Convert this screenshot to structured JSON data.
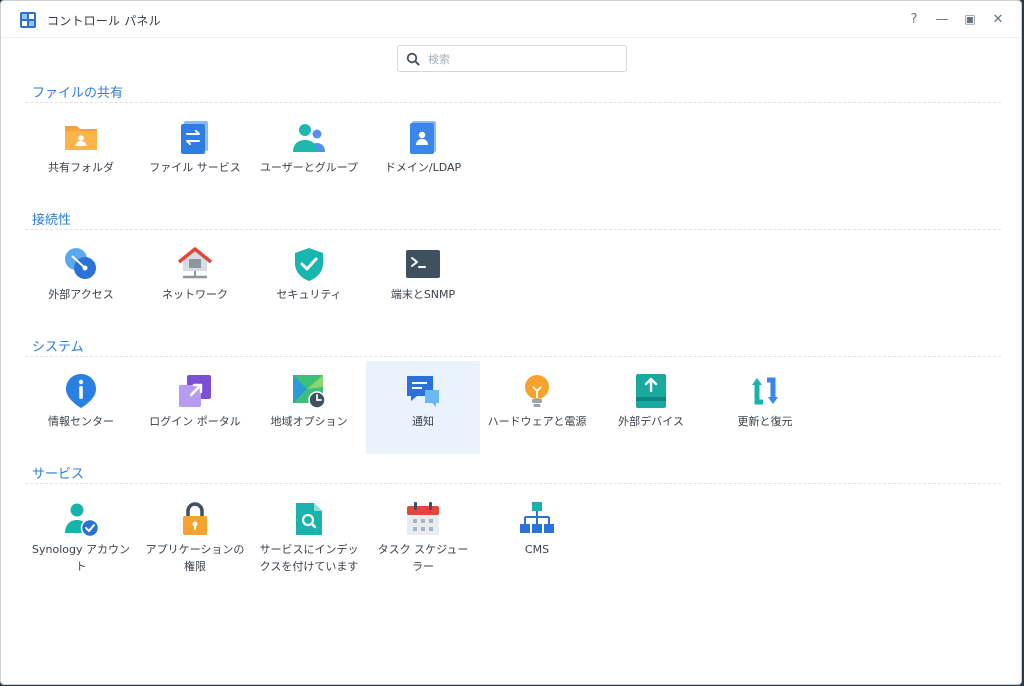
{
  "window": {
    "title": "コントロール パネル",
    "controls": {
      "help": "?",
      "minimize": "—",
      "maximize": "▣",
      "close": "✕"
    }
  },
  "search": {
    "placeholder": "検索",
    "value": ""
  },
  "colors": {
    "accent": "#2b7ed4",
    "selected_tile_bg": "#eaf2fb"
  },
  "sections": [
    {
      "title": "ファイルの共有",
      "items": [
        {
          "label": "共有フォルダ",
          "icon": "shared-folder-icon"
        },
        {
          "label": "ファイル サービス",
          "icon": "file-services-icon"
        },
        {
          "label": "ユーザーとグループ",
          "icon": "user-group-icon"
        },
        {
          "label": "ドメイン/LDAP",
          "icon": "domain-ldap-icon"
        }
      ]
    },
    {
      "title": "接続性",
      "items": [
        {
          "label": "外部アクセス",
          "icon": "external-access-icon"
        },
        {
          "label": "ネットワーク",
          "icon": "network-icon"
        },
        {
          "label": "セキュリティ",
          "icon": "security-shield-icon"
        },
        {
          "label": "端末とSNMP",
          "icon": "terminal-icon"
        }
      ]
    },
    {
      "title": "システム",
      "items": [
        {
          "label": "情報センター",
          "icon": "info-center-icon"
        },
        {
          "label": "ログイン ポータル",
          "icon": "login-portal-icon"
        },
        {
          "label": "地域オプション",
          "icon": "regional-options-icon"
        },
        {
          "label": "通知",
          "icon": "notification-icon",
          "selected": true
        },
        {
          "label": "ハードウェアと電源",
          "icon": "hardware-power-icon"
        },
        {
          "label": "外部デバイス",
          "icon": "external-devices-icon"
        },
        {
          "label": "更新と復元",
          "icon": "update-restore-icon"
        }
      ]
    },
    {
      "title": "サービス",
      "items": [
        {
          "label_line1": "Synology アカウン",
          "label_line2": "ト",
          "icon": "synology-account-icon"
        },
        {
          "label_line1": "アプリケーションの",
          "label_line2": "権限",
          "icon": "application-privileges-icon"
        },
        {
          "label_line1": "サービスにインデッ",
          "label_line2": "クスを付けています",
          "icon": "indexing-service-icon"
        },
        {
          "label_line1": "タスク スケジュー",
          "label_line2": "ラー",
          "icon": "task-scheduler-icon"
        },
        {
          "label": "CMS",
          "icon": "cms-icon"
        }
      ]
    }
  ]
}
